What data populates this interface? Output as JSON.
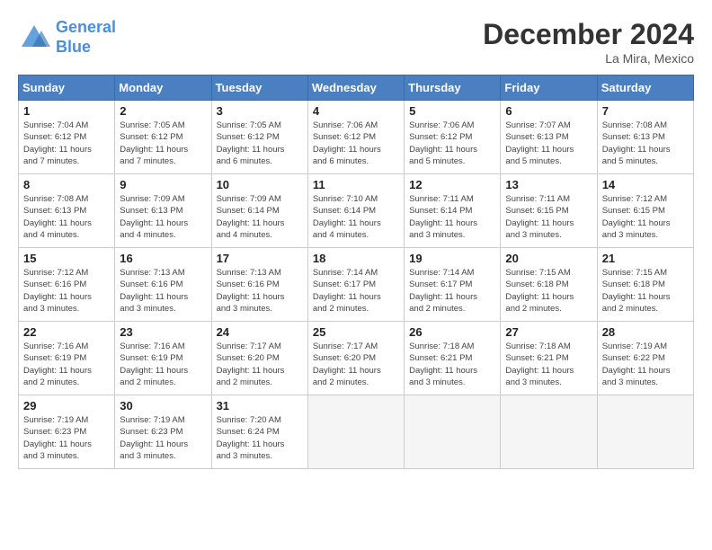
{
  "header": {
    "logo_line1": "General",
    "logo_line2": "Blue",
    "month": "December 2024",
    "location": "La Mira, Mexico"
  },
  "weekdays": [
    "Sunday",
    "Monday",
    "Tuesday",
    "Wednesday",
    "Thursday",
    "Friday",
    "Saturday"
  ],
  "weeks": [
    [
      {
        "day": 1,
        "info": "Sunrise: 7:04 AM\nSunset: 6:12 PM\nDaylight: 11 hours\nand 7 minutes."
      },
      {
        "day": 2,
        "info": "Sunrise: 7:05 AM\nSunset: 6:12 PM\nDaylight: 11 hours\nand 7 minutes."
      },
      {
        "day": 3,
        "info": "Sunrise: 7:05 AM\nSunset: 6:12 PM\nDaylight: 11 hours\nand 6 minutes."
      },
      {
        "day": 4,
        "info": "Sunrise: 7:06 AM\nSunset: 6:12 PM\nDaylight: 11 hours\nand 6 minutes."
      },
      {
        "day": 5,
        "info": "Sunrise: 7:06 AM\nSunset: 6:12 PM\nDaylight: 11 hours\nand 5 minutes."
      },
      {
        "day": 6,
        "info": "Sunrise: 7:07 AM\nSunset: 6:13 PM\nDaylight: 11 hours\nand 5 minutes."
      },
      {
        "day": 7,
        "info": "Sunrise: 7:08 AM\nSunset: 6:13 PM\nDaylight: 11 hours\nand 5 minutes."
      }
    ],
    [
      {
        "day": 8,
        "info": "Sunrise: 7:08 AM\nSunset: 6:13 PM\nDaylight: 11 hours\nand 4 minutes."
      },
      {
        "day": 9,
        "info": "Sunrise: 7:09 AM\nSunset: 6:13 PM\nDaylight: 11 hours\nand 4 minutes."
      },
      {
        "day": 10,
        "info": "Sunrise: 7:09 AM\nSunset: 6:14 PM\nDaylight: 11 hours\nand 4 minutes."
      },
      {
        "day": 11,
        "info": "Sunrise: 7:10 AM\nSunset: 6:14 PM\nDaylight: 11 hours\nand 4 minutes."
      },
      {
        "day": 12,
        "info": "Sunrise: 7:11 AM\nSunset: 6:14 PM\nDaylight: 11 hours\nand 3 minutes."
      },
      {
        "day": 13,
        "info": "Sunrise: 7:11 AM\nSunset: 6:15 PM\nDaylight: 11 hours\nand 3 minutes."
      },
      {
        "day": 14,
        "info": "Sunrise: 7:12 AM\nSunset: 6:15 PM\nDaylight: 11 hours\nand 3 minutes."
      }
    ],
    [
      {
        "day": 15,
        "info": "Sunrise: 7:12 AM\nSunset: 6:16 PM\nDaylight: 11 hours\nand 3 minutes."
      },
      {
        "day": 16,
        "info": "Sunrise: 7:13 AM\nSunset: 6:16 PM\nDaylight: 11 hours\nand 3 minutes."
      },
      {
        "day": 17,
        "info": "Sunrise: 7:13 AM\nSunset: 6:16 PM\nDaylight: 11 hours\nand 3 minutes."
      },
      {
        "day": 18,
        "info": "Sunrise: 7:14 AM\nSunset: 6:17 PM\nDaylight: 11 hours\nand 2 minutes."
      },
      {
        "day": 19,
        "info": "Sunrise: 7:14 AM\nSunset: 6:17 PM\nDaylight: 11 hours\nand 2 minutes."
      },
      {
        "day": 20,
        "info": "Sunrise: 7:15 AM\nSunset: 6:18 PM\nDaylight: 11 hours\nand 2 minutes."
      },
      {
        "day": 21,
        "info": "Sunrise: 7:15 AM\nSunset: 6:18 PM\nDaylight: 11 hours\nand 2 minutes."
      }
    ],
    [
      {
        "day": 22,
        "info": "Sunrise: 7:16 AM\nSunset: 6:19 PM\nDaylight: 11 hours\nand 2 minutes."
      },
      {
        "day": 23,
        "info": "Sunrise: 7:16 AM\nSunset: 6:19 PM\nDaylight: 11 hours\nand 2 minutes."
      },
      {
        "day": 24,
        "info": "Sunrise: 7:17 AM\nSunset: 6:20 PM\nDaylight: 11 hours\nand 2 minutes."
      },
      {
        "day": 25,
        "info": "Sunrise: 7:17 AM\nSunset: 6:20 PM\nDaylight: 11 hours\nand 2 minutes."
      },
      {
        "day": 26,
        "info": "Sunrise: 7:18 AM\nSunset: 6:21 PM\nDaylight: 11 hours\nand 3 minutes."
      },
      {
        "day": 27,
        "info": "Sunrise: 7:18 AM\nSunset: 6:21 PM\nDaylight: 11 hours\nand 3 minutes."
      },
      {
        "day": 28,
        "info": "Sunrise: 7:19 AM\nSunset: 6:22 PM\nDaylight: 11 hours\nand 3 minutes."
      }
    ],
    [
      {
        "day": 29,
        "info": "Sunrise: 7:19 AM\nSunset: 6:23 PM\nDaylight: 11 hours\nand 3 minutes."
      },
      {
        "day": 30,
        "info": "Sunrise: 7:19 AM\nSunset: 6:23 PM\nDaylight: 11 hours\nand 3 minutes."
      },
      {
        "day": 31,
        "info": "Sunrise: 7:20 AM\nSunset: 6:24 PM\nDaylight: 11 hours\nand 3 minutes."
      },
      null,
      null,
      null,
      null
    ]
  ]
}
